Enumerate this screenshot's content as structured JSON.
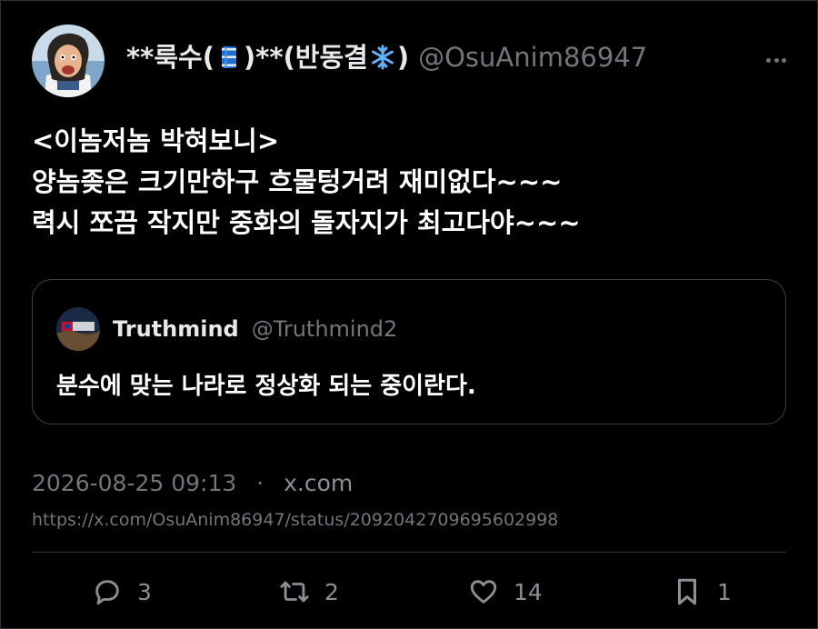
{
  "tweet": {
    "display_name_prefix": "**룩수(",
    "display_name_middle": ")**(반동결",
    "display_name_suffix": ")",
    "emoji_1": "barrel-emoji",
    "emoji_2": "snowflake-emoji",
    "handle": "@OsuAnim86947",
    "lines": [
      "<이놈저놈 박혀보니>",
      "양놈좆은 크기만하구 흐물텅거려 재미없다~~~",
      "력시 쪼끔 작지만 중화의 돌자지가 최고다야~~~"
    ]
  },
  "quote": {
    "name": "Truthmind",
    "handle": "@Truthmind2",
    "text": "분수에 맞는 나라로 정상화 되는 중이란다."
  },
  "meta": {
    "timestamp": "2026-08-25 09:13",
    "separator": "·",
    "source": "x.com",
    "url": "https://x.com/OsuAnim86947/status/2092042709695602998"
  },
  "actions": {
    "replies": "3",
    "reposts": "2",
    "likes": "14",
    "bookmarks": "1"
  },
  "colors": {
    "background": "#000000",
    "text": "#ffffff",
    "muted": "#71767b",
    "border": "#2f3336"
  },
  "icons": [
    "more-icon",
    "reply-icon",
    "repost-icon",
    "like-icon",
    "bookmark-icon"
  ]
}
